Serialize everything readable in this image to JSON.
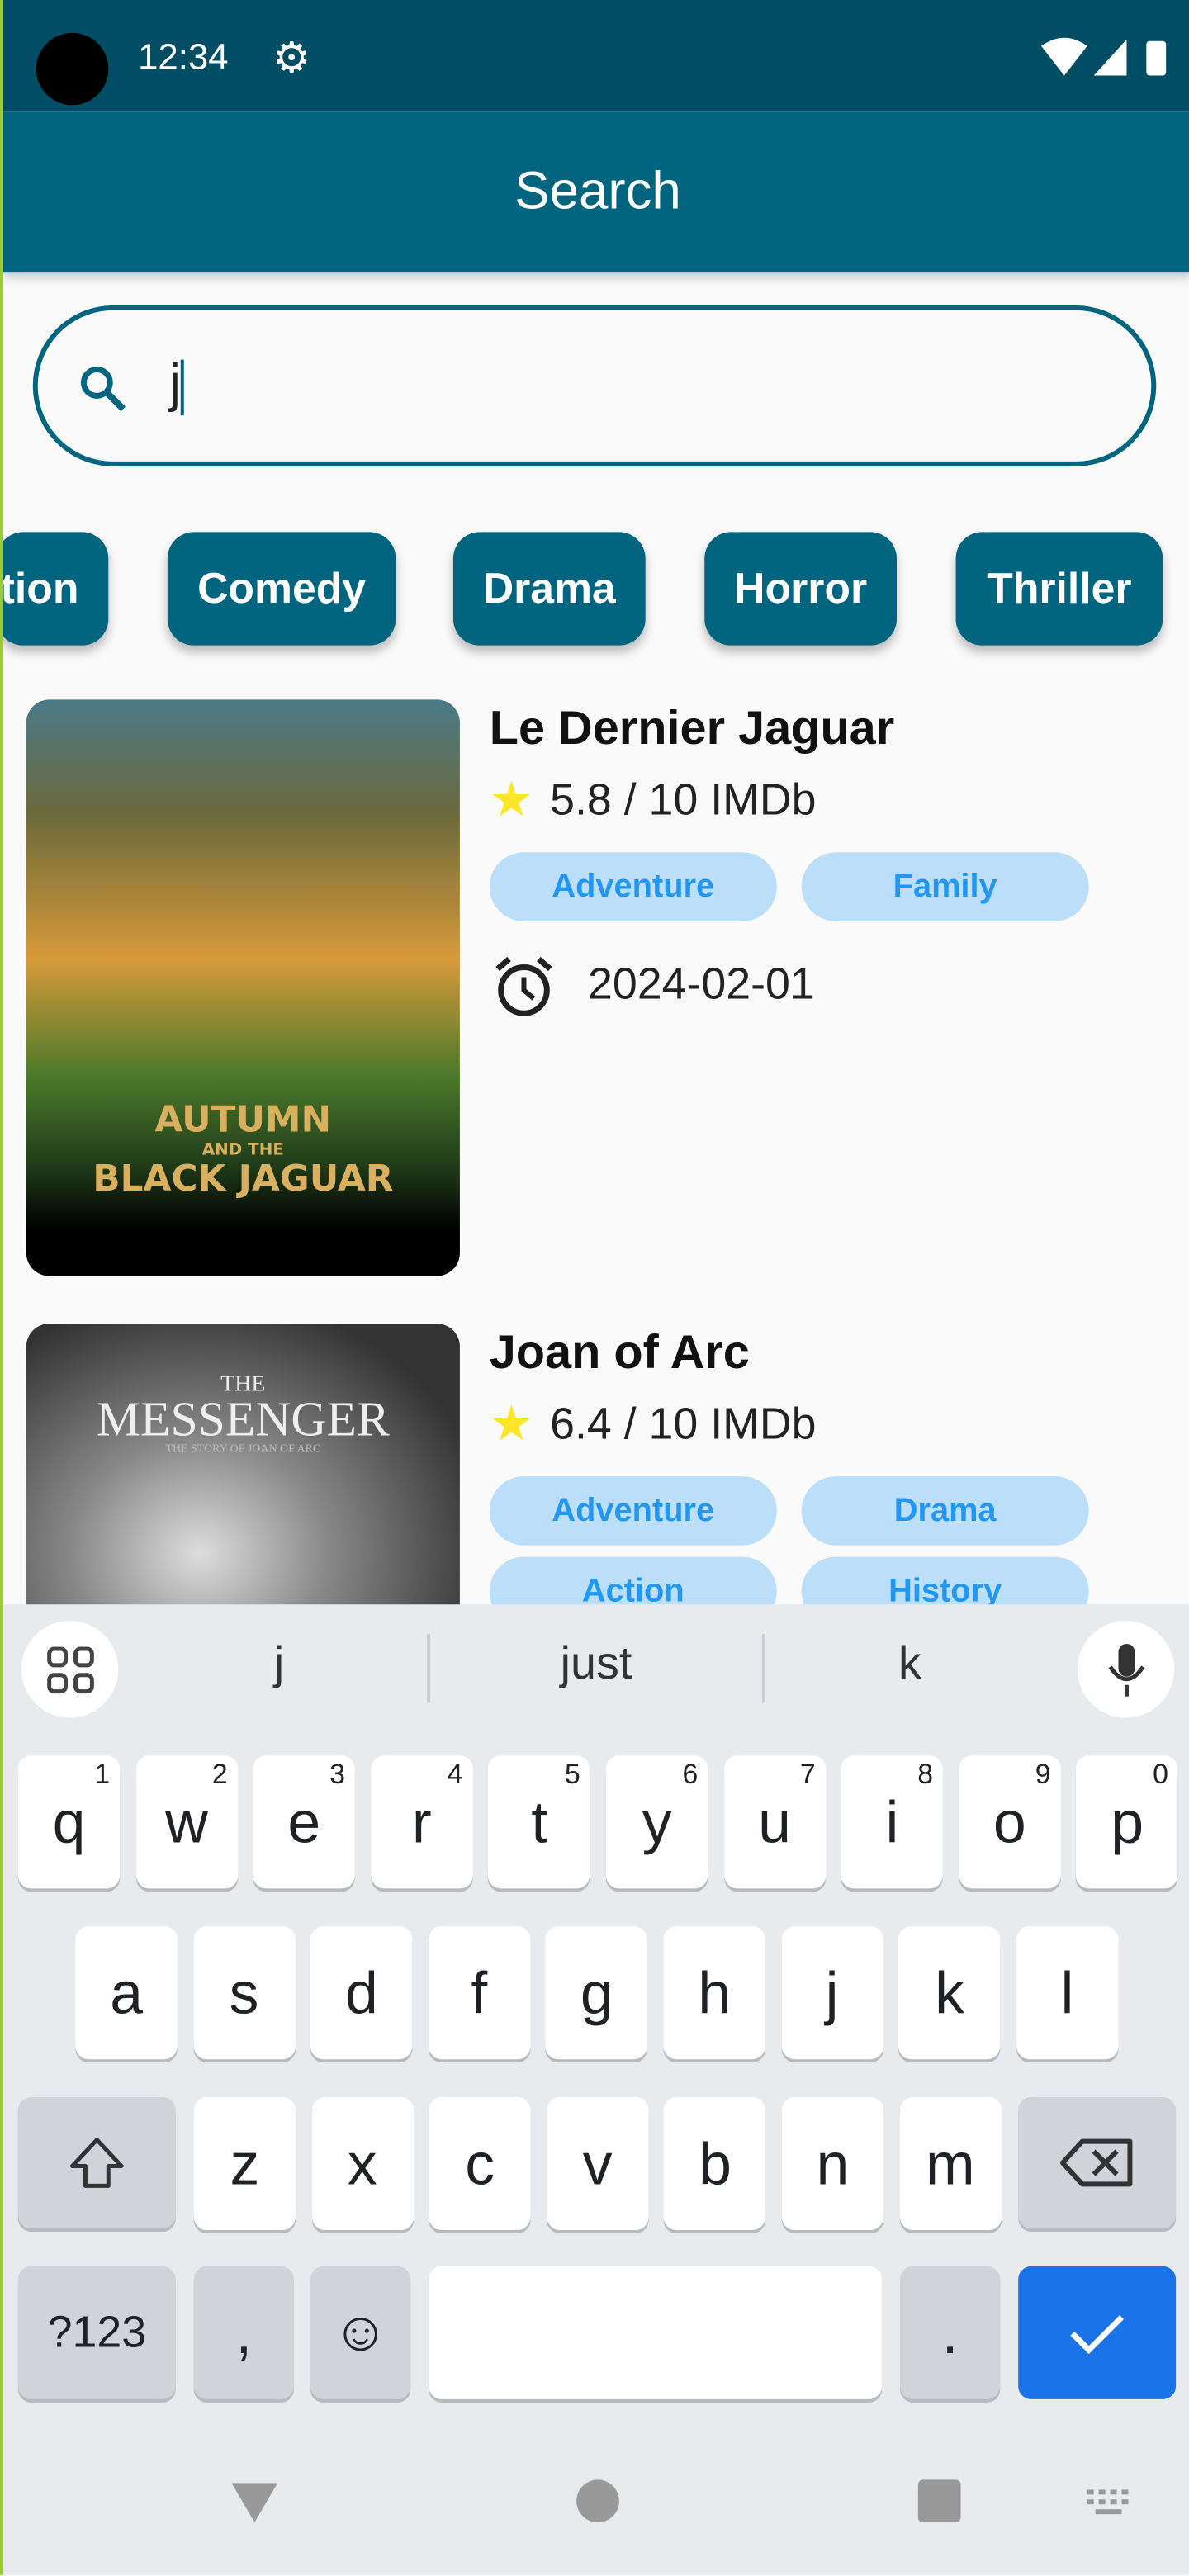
{
  "status": {
    "time": "12:34",
    "icons": [
      "settings-icon",
      "wifi-icon",
      "signal-icon",
      "battery-icon"
    ]
  },
  "appbar": {
    "title": "Search"
  },
  "search": {
    "value": "j",
    "icon": "search-icon"
  },
  "genres": [
    "tion",
    "Comedy",
    "Drama",
    "Horror",
    "Thriller"
  ],
  "movies": [
    {
      "title": "Le Dernier Jaguar",
      "rating": "5.8 / 10 IMDb",
      "tags": [
        "Adventure",
        "Family"
      ],
      "date": "2024-02-01",
      "poster_text": [
        "AUTUMN",
        "AND THE",
        "BLACK JAGUAR"
      ]
    },
    {
      "title": "Joan of Arc",
      "rating": "6.4 / 10 IMDb",
      "tags": [
        "Adventure",
        "Drama",
        "Action",
        "History"
      ],
      "poster_text": [
        "THE",
        "MESSENGER",
        "THE STORY OF JOAN OF ARC"
      ]
    }
  ],
  "keyboard": {
    "suggestions": [
      "j",
      "just",
      "k"
    ],
    "row1": [
      [
        "q",
        "1"
      ],
      [
        "w",
        "2"
      ],
      [
        "e",
        "3"
      ],
      [
        "r",
        "4"
      ],
      [
        "t",
        "5"
      ],
      [
        "y",
        "6"
      ],
      [
        "u",
        "7"
      ],
      [
        "i",
        "8"
      ],
      [
        "o",
        "9"
      ],
      [
        "p",
        "0"
      ]
    ],
    "row2": [
      "a",
      "s",
      "d",
      "f",
      "g",
      "h",
      "j",
      "k",
      "l"
    ],
    "row3": [
      "z",
      "x",
      "c",
      "v",
      "b",
      "n",
      "m"
    ],
    "symbols": "?123",
    "comma": ",",
    "period": ".",
    "accent": "#1a73e8"
  },
  "colors": {
    "primary": "#016580",
    "status_bar": "#014d63",
    "tag_bg": "#bbdefb",
    "tag_text": "#2196f3"
  }
}
